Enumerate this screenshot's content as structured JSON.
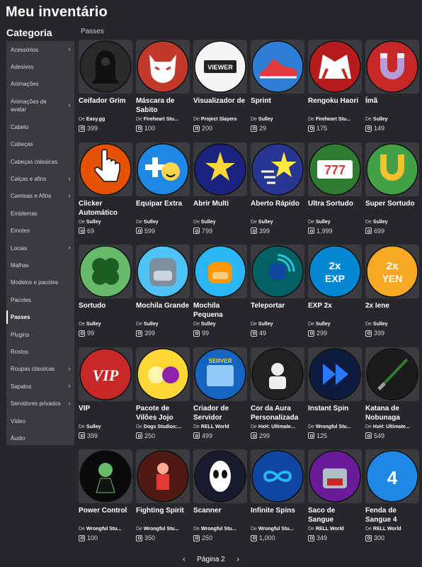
{
  "page_title": "Meu inventário",
  "category_title": "Categoria",
  "section_label": "Passes",
  "sidebar": [
    {
      "label": "Acessórios",
      "chev": true
    },
    {
      "label": "Adesivos",
      "chev": false
    },
    {
      "label": "Animações",
      "chev": false
    },
    {
      "label": "Animações de avatar",
      "chev": true,
      "double": true
    },
    {
      "label": "Cabelo",
      "chev": false
    },
    {
      "label": "Cabeças",
      "chev": false
    },
    {
      "label": "Cabeças clássicas",
      "chev": false
    },
    {
      "label": "Calças e afins",
      "chev": true
    },
    {
      "label": "Camisas e Afins",
      "chev": true
    },
    {
      "label": "Emblemas",
      "chev": false
    },
    {
      "label": "Emotes",
      "chev": false
    },
    {
      "label": "Locais",
      "chev": true
    },
    {
      "label": "Malhas",
      "chev": false
    },
    {
      "label": "Modelos e pacotes",
      "chev": false
    },
    {
      "label": "Pacotes",
      "chev": false
    },
    {
      "label": "Passes",
      "chev": false,
      "active": true
    },
    {
      "label": "Plugins",
      "chev": false
    },
    {
      "label": "Rostos",
      "chev": false
    },
    {
      "label": "Roupas clássicas",
      "chev": true
    },
    {
      "label": "Sapatos",
      "chev": true
    },
    {
      "label": "Servidores privados",
      "chev": true
    },
    {
      "label": "Vídeo",
      "chev": false
    },
    {
      "label": "Áudio",
      "chev": false
    }
  ],
  "creator_prefix": "De",
  "items": [
    {
      "name": "Ceifador Grim",
      "creator": "Easy.gg",
      "price": "399",
      "icon": "reaper-icon",
      "bg": "#2a2a2a",
      "fg": "#111"
    },
    {
      "name": "Máscara de Sabito",
      "creator": "Fireheart Stu...",
      "price": "100",
      "icon": "fox-mask-icon",
      "bg": "#c0392b",
      "fg": "#ffffff"
    },
    {
      "name": "Visualizador de",
      "creator": "Project Slayers",
      "price": "200",
      "icon": "viewer-icon",
      "bg": "#f5f5f5",
      "fg": "#222"
    },
    {
      "name": "Sprint",
      "creator": "Sulley",
      "price": "29",
      "icon": "shoe-icon",
      "bg": "#2e7dd7",
      "fg": "#e23b3b"
    },
    {
      "name": "Rengoku Haori",
      "creator": "Fireheart Stu...",
      "price": "175",
      "icon": "haori-icon",
      "bg": "#b71c1c",
      "fg": "#ffffff"
    },
    {
      "name": "Ímã",
      "creator": "Sulley",
      "price": "149",
      "icon": "magnet-icon",
      "bg": "#c62828",
      "fg": "#b39ddb"
    },
    {
      "name": "Clicker Automático",
      "creator": "Sulley",
      "price": "69",
      "icon": "hand-cursor-icon",
      "bg": "#e65100",
      "fg": "#ffffff"
    },
    {
      "name": "Equipar Extra",
      "creator": "Sulley",
      "price": "599",
      "icon": "plus-smiley-icon",
      "bg": "#1e88e5",
      "fg": "#ffd54f"
    },
    {
      "name": "Abrir Multi",
      "creator": "Sulley",
      "price": "799",
      "icon": "stars-icon",
      "bg": "#1a237e",
      "fg": "#fdd835"
    },
    {
      "name": "Aberto Rápido",
      "creator": "Sulley",
      "price": "399",
      "icon": "fast-star-icon",
      "bg": "#283593",
      "fg": "#ffeb3b"
    },
    {
      "name": "Ultra Sortudo",
      "creator": "Sulley",
      "price": "1,999",
      "icon": "slot-777-icon",
      "bg": "#2e7d32",
      "fg": "#e53935"
    },
    {
      "name": "Super Sortudo",
      "creator": "Sulley",
      "price": "699",
      "icon": "horseshoe-icon",
      "bg": "#43a047",
      "fg": "#fbc02d"
    },
    {
      "name": "Sortudo",
      "creator": "Sulley",
      "price": "99",
      "icon": "clover-icon",
      "bg": "#66bb6a",
      "fg": "#1b5e20"
    },
    {
      "name": "Mochila Grande",
      "creator": "Sulley",
      "price": "399",
      "icon": "backpack-large-icon",
      "bg": "#4fc3f7",
      "fg": "#7e8f9e"
    },
    {
      "name": "Mochila Pequena",
      "creator": "Sulley",
      "price": "99",
      "icon": "backpack-small-icon",
      "bg": "#29b6f6",
      "fg": "#ff9800"
    },
    {
      "name": "Teleportar",
      "creator": "Sulley",
      "price": "49",
      "icon": "teleport-icon",
      "bg": "#006064",
      "fg": "#26c6da"
    },
    {
      "name": "EXP 2x",
      "creator": "Sulley",
      "price": "299",
      "icon": "exp-2x-icon",
      "bg": "#0288d1",
      "fg": "#ffffff"
    },
    {
      "name": "2x Iene",
      "creator": "Sulley",
      "price": "399",
      "icon": "yen-2x-icon",
      "bg": "#f9a825",
      "fg": "#ffffff"
    },
    {
      "name": "VIP",
      "creator": "Sulley",
      "price": "399",
      "icon": "vip-icon",
      "bg": "#c62828",
      "fg": "#ffffff"
    },
    {
      "name": "Pacote de Vilões Jojo",
      "creator": "Dogs Studios:...",
      "price": "250",
      "icon": "jojo-villains-icon",
      "bg": "#fdd835",
      "fg": "#8e24aa"
    },
    {
      "name": "Criador de Servidor",
      "creator": "RELL World",
      "price": "499",
      "icon": "server-icon",
      "bg": "#1565c0",
      "fg": "#fdd835"
    },
    {
      "name": "Cor da Aura Personalizada",
      "creator": "HxH: Ultimate...",
      "price": "299",
      "icon": "aura-icon",
      "bg": "#212121",
      "fg": "#eeeeee"
    },
    {
      "name": "Instant Spin",
      "creator": "Wrongful Stu...",
      "price": "125",
      "icon": "fast-forward-icon",
      "bg": "#0d1b3e",
      "fg": "#2979ff"
    },
    {
      "name": "Katana de Nobunaga",
      "creator": "HxH: Ultimate...",
      "price": "549",
      "icon": "katana-icon",
      "bg": "#1b1b1b",
      "fg": "#2e7d32"
    },
    {
      "name": "Power Control",
      "creator": "Wrongful Stu...",
      "price": "100",
      "icon": "power-girl-icon",
      "bg": "#0a0a0a",
      "fg": "#2e7d32"
    },
    {
      "name": "Fighting Spirit",
      "creator": "Wrongful Stu...",
      "price": "350",
      "icon": "fighter-icon",
      "bg": "#4e1a12",
      "fg": "#e53935"
    },
    {
      "name": "Scanner",
      "creator": "Wrongful Stu...",
      "price": "250",
      "icon": "mask-scanner-icon",
      "bg": "#1a1a2e",
      "fg": "#ffffff"
    },
    {
      "name": "Infinite Spins",
      "creator": "Wrongful Stu...",
      "price": "1,000",
      "icon": "infinity-icon",
      "bg": "#0d47a1",
      "fg": "#29b6f6"
    },
    {
      "name": "Saco de Sangue",
      "creator": "RELL World",
      "price": "349",
      "icon": "blood-bag-icon",
      "bg": "#6a1b9a",
      "fg": "#b0bec5"
    },
    {
      "name": "Fenda de Sangue 4",
      "creator": "RELL World",
      "price": "300",
      "icon": "blood-rift-icon",
      "bg": "#1e88e5",
      "fg": "#ffffff"
    }
  ],
  "pager": {
    "label": "Página 2",
    "prev": "‹",
    "next": "›"
  }
}
